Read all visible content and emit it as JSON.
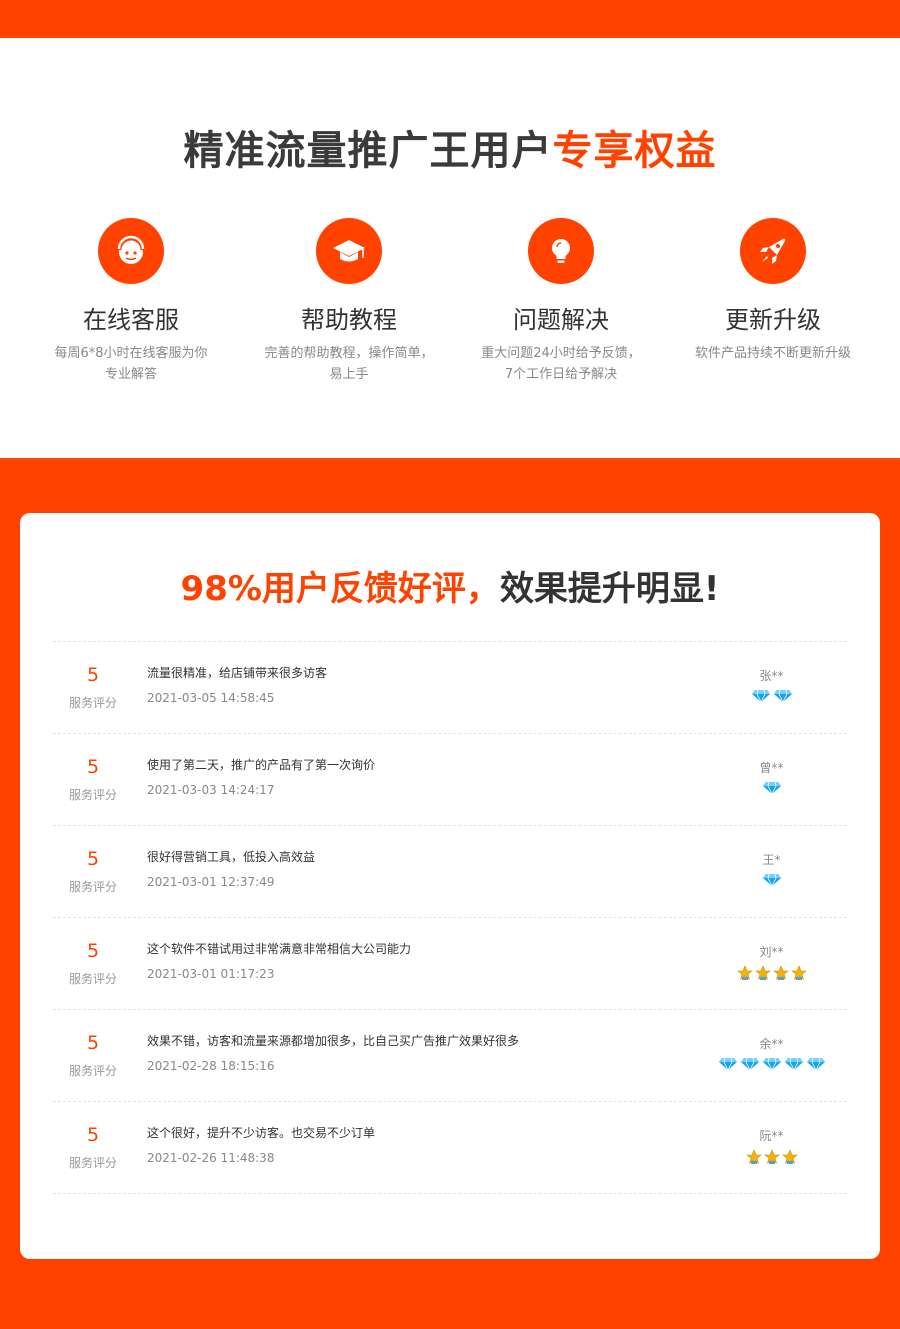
{
  "benefits": {
    "title_main": "精准流量推广王用户",
    "title_highlight": "专享权益",
    "items": [
      {
        "icon": "customer-service-icon",
        "title": "在线客服",
        "desc1": "每周6*8小时在线客服为你",
        "desc2": "专业解答"
      },
      {
        "icon": "graduation-cap-icon",
        "title": "帮助教程",
        "desc1": "完善的帮助教程，操作简单，",
        "desc2": "易上手"
      },
      {
        "icon": "lightbulb-icon",
        "title": "问题解决",
        "desc1": "重大问题24小时给予反馈，",
        "desc2": "7个工作日给予解决"
      },
      {
        "icon": "rocket-icon",
        "title": "更新升级",
        "desc1": "软件产品持续不断更新升级",
        "desc2": ""
      }
    ]
  },
  "reviews": {
    "title_highlight": "98%用户反馈好评，",
    "title_main": "效果提升明显!",
    "score_label": "服务评分",
    "items": [
      {
        "score": "5",
        "text": "流量很精准，给店铺带来很多访客",
        "date": "2021-03-05 14:58:45",
        "user": "张**",
        "badge_type": "diamond",
        "badge_count": 2
      },
      {
        "score": "5",
        "text": "使用了第二天，推广的产品有了第一次询价",
        "date": "2021-03-03 14:24:17",
        "user": "曾**",
        "badge_type": "diamond",
        "badge_count": 1
      },
      {
        "score": "5",
        "text": "很好得营销工具，低投入高效益",
        "date": "2021-03-01 12:37:49",
        "user": "王*",
        "badge_type": "diamond",
        "badge_count": 1
      },
      {
        "score": "5",
        "text": "这个软件不错试用过非常满意非常相信大公司能力",
        "date": "2021-03-01 01:17:23",
        "user": "刘**",
        "badge_type": "crown",
        "badge_count": 4
      },
      {
        "score": "5",
        "text": "效果不错，访客和流量来源都增加很多，比自己买广告推广效果好很多",
        "date": "2021-02-28 18:15:16",
        "user": "余**",
        "badge_type": "diamond",
        "badge_count": 5
      },
      {
        "score": "5",
        "text": "这个很好，提升不少访客。也交易不少订单",
        "date": "2021-02-26 11:48:38",
        "user": "阮**",
        "badge_type": "crown",
        "badge_count": 3
      }
    ]
  },
  "colors": {
    "accent": "#ff4200",
    "diamond": "#1aa3e8",
    "crown": "#f5b400"
  }
}
